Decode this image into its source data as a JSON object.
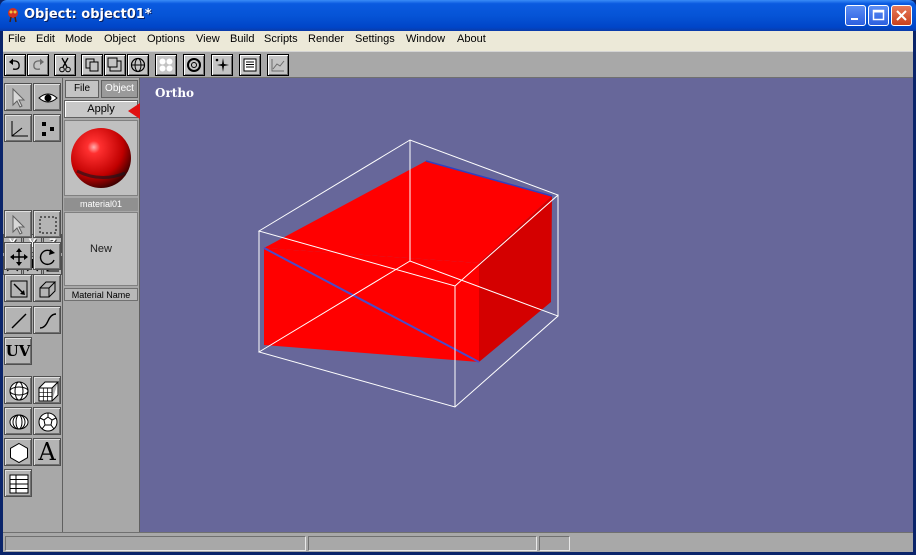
{
  "window": {
    "title": "Object: object01*",
    "title_color": "#ffffff",
    "frame_color": "#0654d6"
  },
  "menubar": {
    "items": [
      "File",
      "Edit",
      "Mode",
      "Object",
      "Options",
      "View",
      "Build",
      "Scripts",
      "Render",
      "Settings",
      "Window",
      "About"
    ]
  },
  "toolbar": {
    "icons": [
      "undo-icon",
      "redo-icon",
      "scissors-icon",
      "copy-icon",
      "paste-icon",
      "globe-icon",
      "grid-dots-icon",
      "circle-icon",
      "sparkle-icon",
      "list-icon",
      "graph-icon"
    ]
  },
  "tools": {
    "axes": [
      "X",
      "Y",
      "Z"
    ],
    "uv_label": "UV",
    "text_tool_label": "A"
  },
  "material_panel": {
    "tabs": [
      "File",
      "Object"
    ],
    "apply_label": "Apply",
    "material_name": "material01",
    "new_label": "New",
    "material_name_header": "Material Name",
    "swatch_color": "#e00000"
  },
  "viewport": {
    "label": "Ortho",
    "background": "#67679a",
    "object_color": "#ff0000"
  },
  "annotation": {
    "arrow_color": "#e01010"
  }
}
